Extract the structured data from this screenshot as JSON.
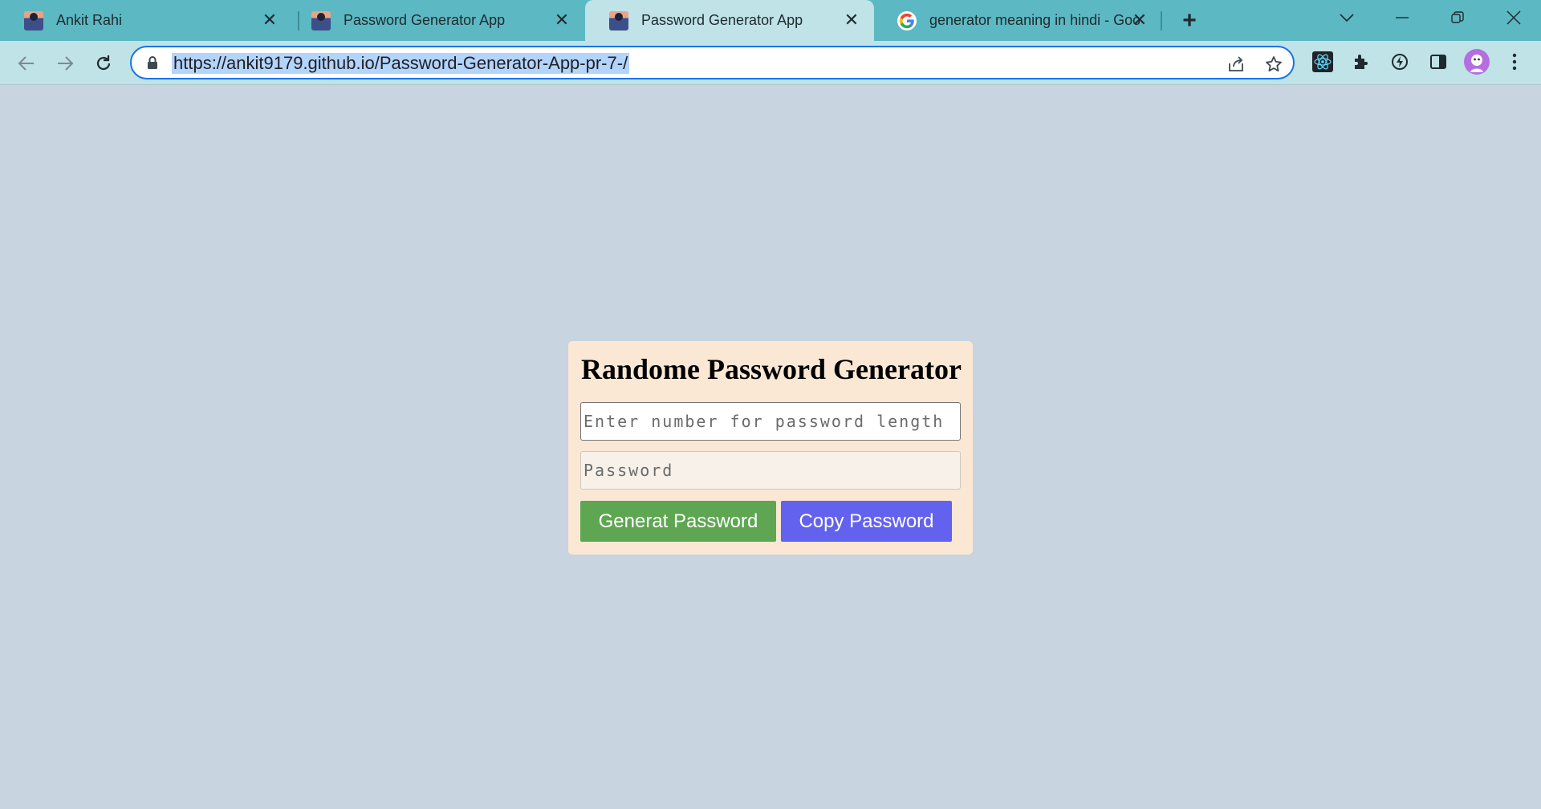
{
  "browser": {
    "tabs": [
      {
        "title": "Ankit Rahi",
        "favicon": "profile-photo-icon",
        "active": false
      },
      {
        "title": "Password Generator App",
        "favicon": "profile-photo-icon",
        "active": false
      },
      {
        "title": "Password Generator App",
        "favicon": "profile-photo-icon",
        "active": true
      },
      {
        "title": "generator meaning in hindi - Goo",
        "favicon": "google-icon",
        "active": false
      }
    ],
    "url": "https://ankit9179.github.io/Password-Generator-App-pr-7-/",
    "accent_color": "#5cb8c2",
    "toolbar_color": "#bfe3e6"
  },
  "page": {
    "heading": "Randome Password Generator",
    "length_input": {
      "placeholder": "Enter number for password length",
      "value": ""
    },
    "password_input": {
      "placeholder": "Password",
      "value": ""
    },
    "generate_label": "Generat Password",
    "copy_label": "Copy Password",
    "colors": {
      "background": "#c8d4df",
      "card": "#fae7d4",
      "generate_button": "#5ea652",
      "copy_button": "#6262ee"
    }
  }
}
